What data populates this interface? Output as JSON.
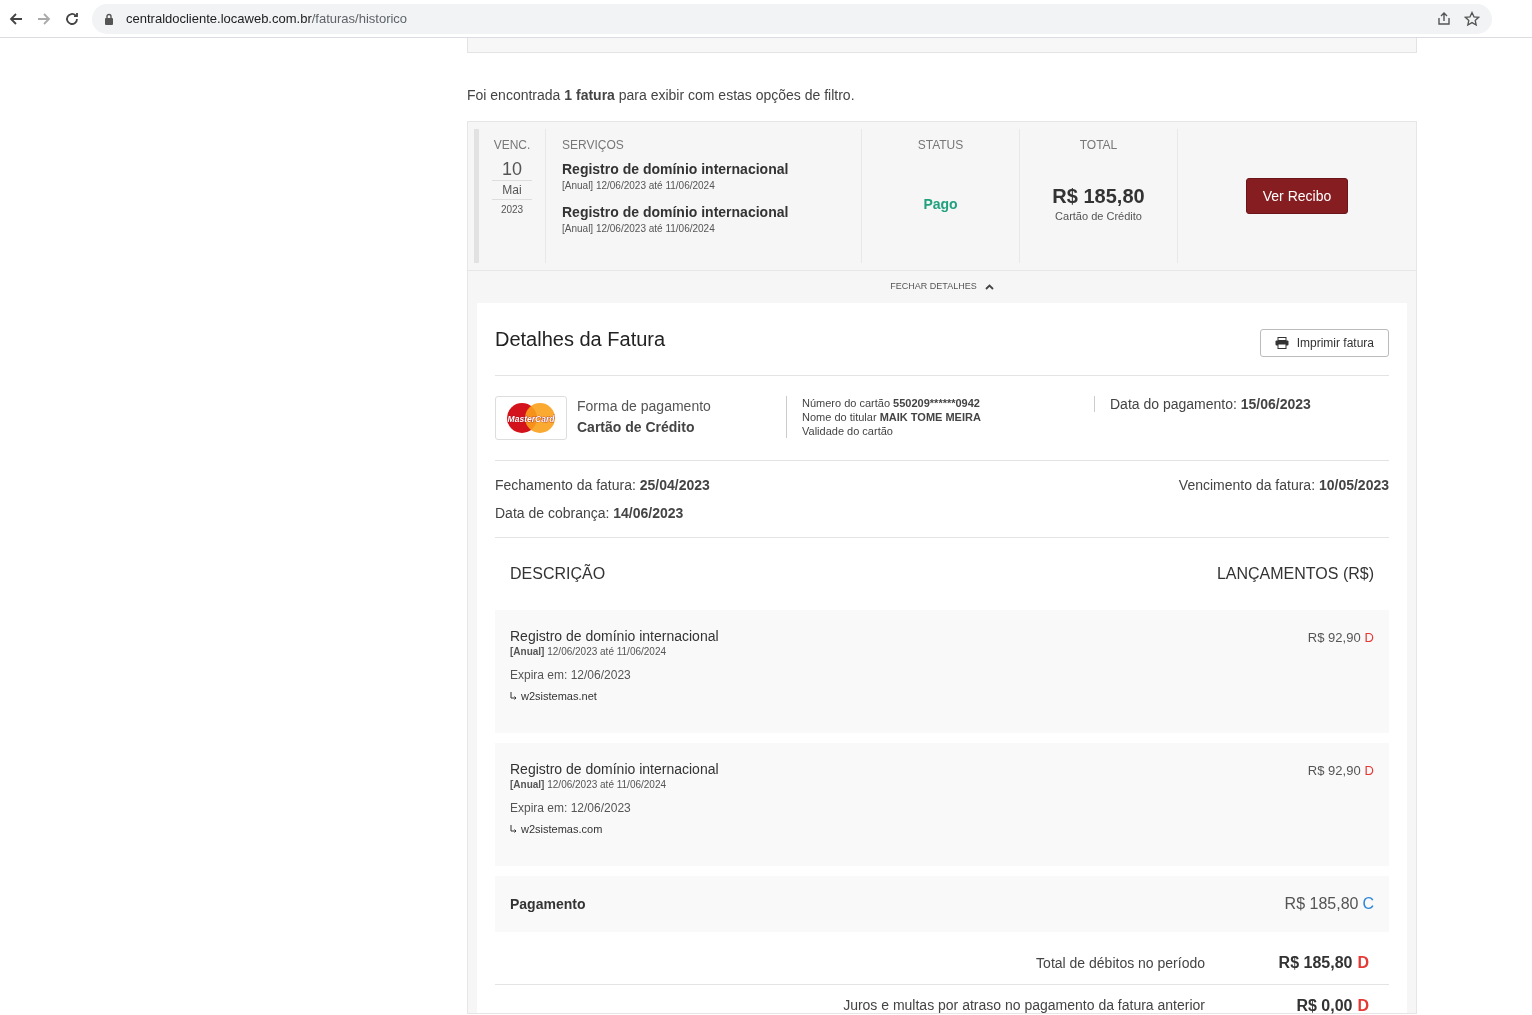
{
  "browser": {
    "url_host": "centraldocliente.locaweb.com.br",
    "url_path": "/faturas/historico"
  },
  "result_text": "Foi encontrada **1 fatura** para exibir com estas opções de filtro.",
  "invoice": {
    "due_label": "VENC.",
    "due_day": "10",
    "due_month": "Mai",
    "due_year": "2023",
    "services_label": "SERVIÇOS",
    "services": [
      {
        "name": "Registro de domínio internacional",
        "period": "[Anual] 12/06/2023 até 11/06/2024"
      },
      {
        "name": "Registro de domínio internacional",
        "period": "[Anual] 12/06/2023 até 11/06/2024"
      }
    ],
    "status_label": "STATUS",
    "status": "Pago",
    "total_label": "TOTAL",
    "total": "R$ 185,80",
    "total_method": "Cartão de Crédito",
    "receipt_button": "Ver Recibo",
    "toggle": "FECHAR DETALHES",
    "expanded": true
  },
  "details": {
    "title": "Detalhes da Fatura",
    "print_button": "Imprimir fatura",
    "payment": {
      "card_brand": "MasterCard",
      "method_label": "Forma de pagamento",
      "method": "Cartão de Crédito",
      "card_number_label": "Número do cartão",
      "card_number": "550209******0942",
      "holder": "Nome do titular **MAIK TOME MEIRA**",
      "validity": "Validade do cartão",
      "paid_date": "Data do pagamento: **15/06/2023**"
    },
    "closing": "Fechamento da fatura: **25/04/2023**",
    "due": "Vencimento da fatura: **10/05/2023**",
    "billing": "Data de cobrança: **14/06/2023**",
    "columns": [
      "DESCRIÇÃO",
      "LANÇAMENTOS (R$)"
    ],
    "entries": [
      {
        "kind": "service",
        "name": "Registro de domínio internacional",
        "period": "**[Anual]** 12/06/2023 até 11/06/2024",
        "expires": "Expira em: 12/06/2023",
        "domain": "w2sistemas.net",
        "amount": "R$ 92,90",
        "flag": "D",
        "color": "#e53935"
      },
      {
        "kind": "service",
        "name": "Registro de domínio internacional",
        "period": "**[Anual]** 12/06/2023 até 11/06/2024",
        "expires": "Expira em: 12/06/2023",
        "domain": "w2sistemas.com",
        "amount": "R$ 92,90",
        "flag": "D",
        "color": "#e53935"
      },
      {
        "kind": "payment",
        "name": "Pagamento",
        "amount": "R$ 185,80",
        "flag": "C",
        "color": "#2f86d6"
      }
    ],
    "totals": [
      {
        "label": "Total de débitos no período",
        "amount": "R$ 185,80",
        "flag": "D",
        "color": "#e53935"
      },
      {
        "label": "Juros e multas por atraso no pagamento da fatura anterior",
        "amount": "R$ 0,00",
        "flag": "D",
        "color": "#e53935"
      }
    ]
  }
}
